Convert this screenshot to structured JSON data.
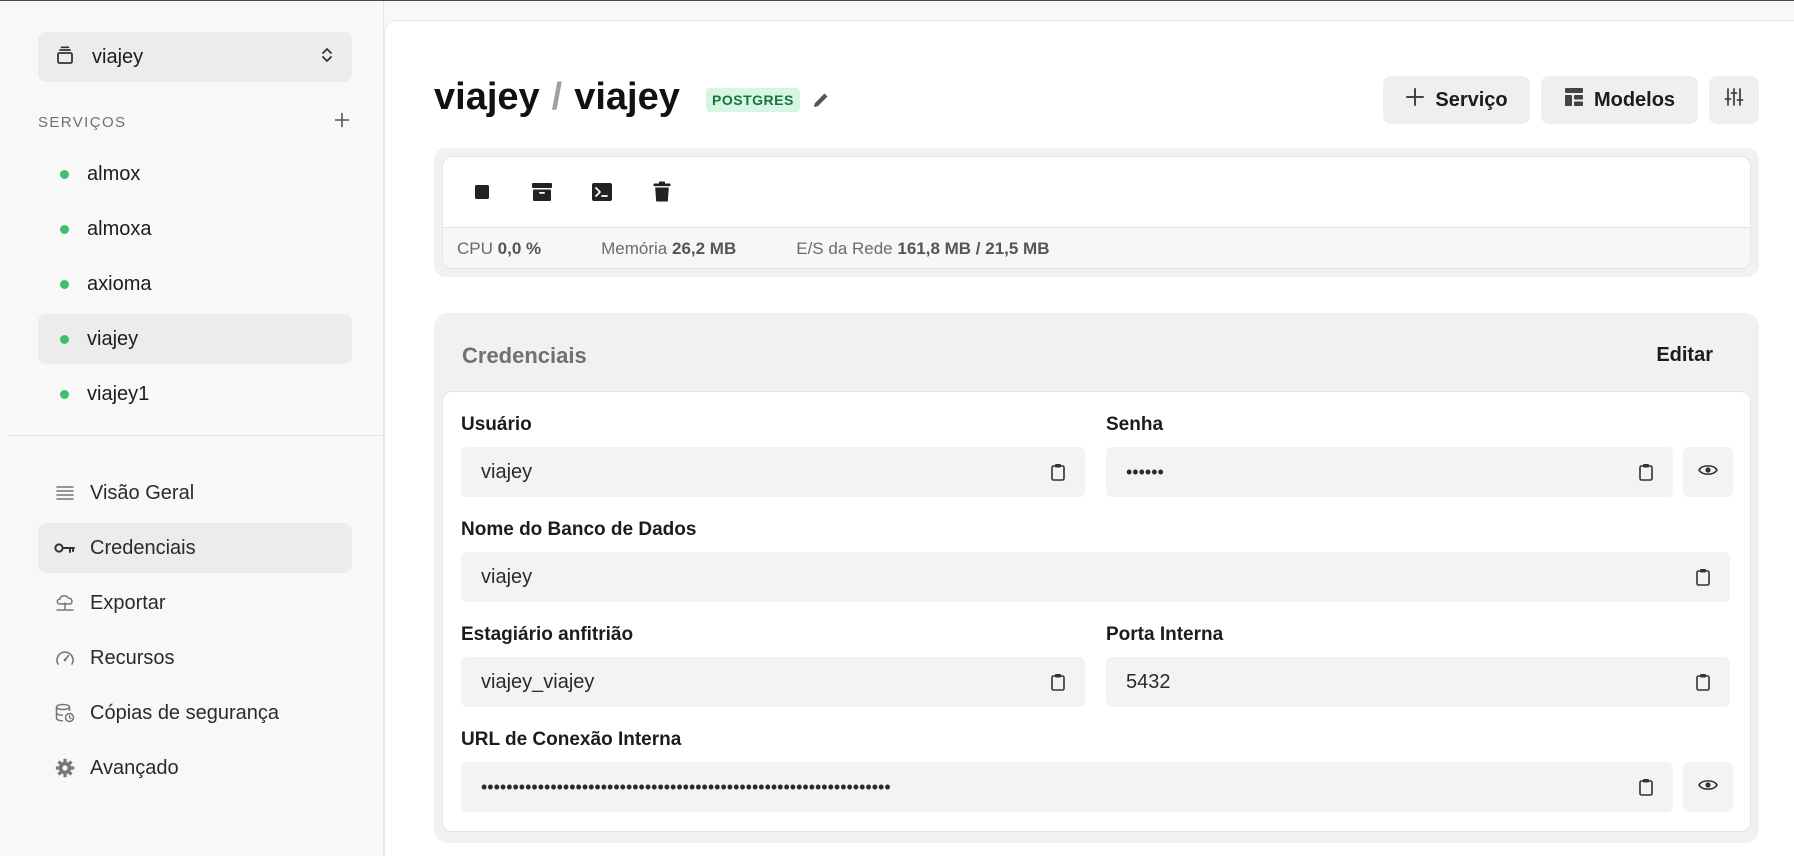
{
  "sidebar": {
    "project": "viajey",
    "services_title": "SERVIÇOS",
    "services": [
      {
        "name": "almox"
      },
      {
        "name": "almoxa"
      },
      {
        "name": "axioma"
      },
      {
        "name": "viajey"
      },
      {
        "name": "viajey1"
      }
    ],
    "nav": [
      {
        "label": "Visão Geral",
        "icon": "list-icon"
      },
      {
        "label": "Credenciais",
        "icon": "key-icon"
      },
      {
        "label": "Exportar",
        "icon": "cloud-export-icon"
      },
      {
        "label": "Recursos",
        "icon": "gauge-icon"
      },
      {
        "label": "Cópias de segurança",
        "icon": "database-backup-icon"
      },
      {
        "label": "Avançado",
        "icon": "gear-icon"
      }
    ]
  },
  "header": {
    "project": "viajey",
    "separator": "/",
    "service": "viajey",
    "badge": "POSTGRES",
    "buttons": {
      "service": "Serviço",
      "models": "Modelos"
    }
  },
  "metrics": {
    "cpu_label": "CPU",
    "cpu_value": "0,0 %",
    "mem_label": "Memória",
    "mem_value": "26,2 MB",
    "net_label": "E/S da Rede",
    "net_value": "161,8 MB / 21,5 MB"
  },
  "credentials": {
    "title": "Credenciais",
    "edit_label": "Editar",
    "user_label": "Usuário",
    "user_value": "viajey",
    "password_label": "Senha",
    "password_value": "••••••",
    "dbname_label": "Nome do Banco de Dados",
    "dbname_value": "viajey",
    "host_label": "Estagiário anfitrião",
    "host_value": "viajey_viajey",
    "port_label": "Porta Interna",
    "port_value": "5432",
    "url_label": "URL de Conexão Interna",
    "url_value": "•••••••••••••••••••••••••••••••••••••••••••••••••••••••••••••••••"
  },
  "colors": {
    "status_dot": "#3fbf6f",
    "badge_bg": "#d6f5e2",
    "badge_text": "#16773d"
  }
}
